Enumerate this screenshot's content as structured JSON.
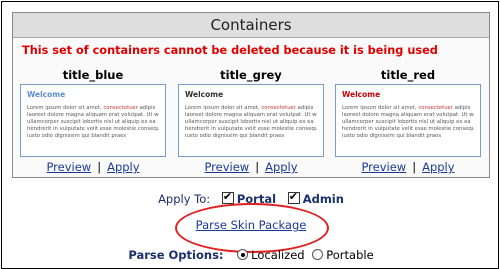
{
  "panel": {
    "title": "Containers",
    "warning": "This set of containers cannot be deleted because it is being used"
  },
  "containers": [
    {
      "name": "title_blue",
      "welcome": "Welcome",
      "welcome_color": "#5b8fd0",
      "lines": [
        [
          "Lorem ipsum dolor sit amet, ",
          "consectetuer",
          " adipis"
        ],
        [
          "laoreet dolore magna aliquam erat volutpat. Ut wi",
          "",
          ""
        ],
        [
          "ullamcorper suscipit lobortis nisl ut aliquip ex ea",
          "",
          ""
        ],
        [
          "hendrerit in vulputate velit esse molestie consequ",
          "",
          ""
        ],
        [
          "iusto odio dignissim qui blandit praes",
          "",
          ""
        ]
      ],
      "preview": "Preview",
      "apply": "Apply"
    },
    {
      "name": "title_grey",
      "welcome": "Welcome",
      "welcome_color": "#333333",
      "lines": [
        [
          "Lorem ipsum dolor sit amet, ",
          "consectetuer",
          " adipis"
        ],
        [
          "laoreet dolore magna aliquam erat volutpat. Ut wi",
          "",
          ""
        ],
        [
          "ullamcorper suscipit lobortis nisl ut aliquip ex ea",
          "",
          ""
        ],
        [
          "hendrerit in vulputate velit esse molestie consequ",
          "",
          ""
        ],
        [
          "iusto odio dignissim qui blandit praes",
          "",
          ""
        ]
      ],
      "preview": "Preview",
      "apply": "Apply"
    },
    {
      "name": "title_red",
      "welcome": "Welcome",
      "welcome_color": "#cc0000",
      "lines": [
        [
          "Lorem ipsum dolor sit amet, ",
          "consectetuer",
          " adipis"
        ],
        [
          "laoreet dolore magna aliquam erat volutpat. Ut wi",
          "",
          ""
        ],
        [
          "ullamcorper suscipit lobortis nisl ut aliquip ex ea",
          "",
          ""
        ],
        [
          "hendrerit in vulputate velit esse molestie consequ",
          "",
          ""
        ],
        [
          "iusto odio dignissim qui blandit praes",
          "",
          ""
        ]
      ],
      "preview": "Preview",
      "apply": "Apply"
    }
  ],
  "separator": "|",
  "apply_to": {
    "label": "Apply To:",
    "portal_label": "Portal",
    "portal_checked": true,
    "admin_label": "Admin",
    "admin_checked": true
  },
  "parse_link": "Parse Skin Package",
  "parse_options": {
    "label": "Parse Options:",
    "localized": "Localized",
    "portable": "Portable",
    "selected": "Localized"
  },
  "colors": {
    "warning": "#e00000",
    "link": "#1a3a9a",
    "highlight_ellipse": "#e02020"
  }
}
